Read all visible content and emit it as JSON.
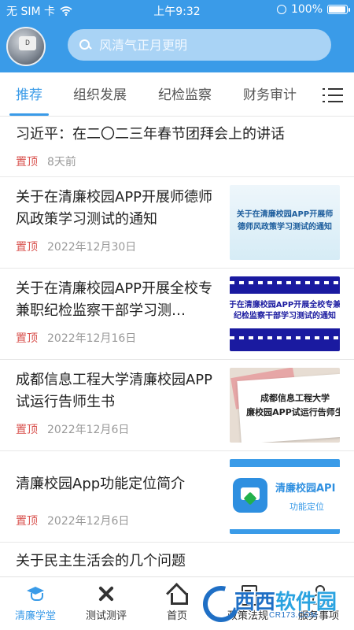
{
  "status_bar": {
    "carrier": "无 SIM 卡",
    "time": "上午9:32",
    "battery": "100%",
    "battery_level": 1.0,
    "icons": [
      "wifi-icon",
      "orientation-lock-icon",
      "battery-icon"
    ]
  },
  "header": {
    "avatar_key": "D",
    "search_placeholder": "风清气正月更明",
    "accent": "#3a9be8"
  },
  "tabs": [
    {
      "label": "推荐",
      "active": true
    },
    {
      "label": "组织发展",
      "active": false
    },
    {
      "label": "纪检监察",
      "active": false
    },
    {
      "label": "财务审计",
      "active": false
    }
  ],
  "feed": [
    {
      "title": "习近平：在二〇二三年春节团拜会上的讲话",
      "pin": "置顶",
      "date": "8天前",
      "thumb": null
    },
    {
      "title": "关于在清廉校园APP开展师德师风政策学习测试的通知",
      "pin": "置顶",
      "date": "2022年12月30日",
      "thumb_text": "关于在清廉校园APP开展师德师风政策学习测试的通知"
    },
    {
      "title": "关于在清廉校园APP开展全校专兼职纪检监察干部学习测…",
      "pin": "置顶",
      "date": "2022年12月16日",
      "thumb_text_1": "于在清廉校园APP开展全校专兼",
      "thumb_text_2": "纪检监察干部学习测试的通知"
    },
    {
      "title": "成都信息工程大学清廉校园APP试运行告师生书",
      "pin": "置顶",
      "date": "2022年12月6日",
      "thumb_text_1": "成都信息工程大学",
      "thumb_text_2": "廉校园APP试运行告师生"
    },
    {
      "title": "清廉校园App功能定位简介",
      "pin": "置顶",
      "date": "2022年12月6日",
      "thumb_name": "清廉校园API",
      "thumb_sub": "功能定位"
    },
    {
      "title": "关于民主生活会的几个问题"
    }
  ],
  "bottom_nav": [
    {
      "label": "清廉学堂",
      "icon": "graduation-cap-icon",
      "active": true
    },
    {
      "label": "测试测评",
      "icon": "tools-icon",
      "active": false
    },
    {
      "label": "首页",
      "icon": "home-icon",
      "active": false
    },
    {
      "label": "政策法规",
      "icon": "book-icon",
      "active": false
    },
    {
      "label": "服务事项",
      "icon": "person-icon",
      "active": false
    }
  ],
  "watermark": {
    "text_1": "西西",
    "text_2": "软件园",
    "url": "CR173.COM"
  }
}
